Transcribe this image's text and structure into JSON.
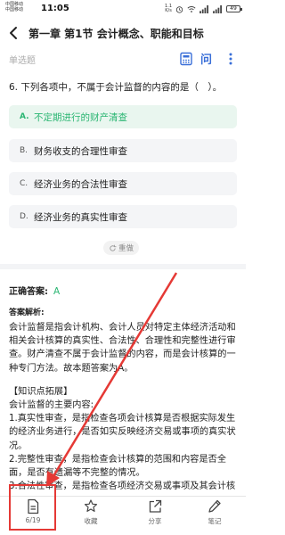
{
  "status_bar": {
    "carrier_1": "中国移动",
    "carrier_2": "中国移动",
    "time": "11:05",
    "net_speed_value": "1.1",
    "net_speed_unit": "K/s",
    "battery": "49"
  },
  "header": {
    "title": "第一章 第1节 会计概念、职能和目标"
  },
  "question": {
    "type_label": "单选题",
    "text": "6. 下列各项中，不属于会计监督的内容的是（　）。",
    "options": [
      {
        "letter": "A.",
        "text": "不定期进行的财产清查",
        "correct": true
      },
      {
        "letter": "B.",
        "text": "财务收支的合理性审查",
        "correct": false
      },
      {
        "letter": "C.",
        "text": "经济业务的合法性审查",
        "correct": false
      },
      {
        "letter": "D.",
        "text": "经济业务的真实性审查",
        "correct": false
      }
    ],
    "redo_label": "重做"
  },
  "answer": {
    "label": "正确答案:",
    "value": "A"
  },
  "analysis": {
    "label": "答案解析:",
    "paragraph_1": "会计监督是指会计机构、会计人员对特定主体经济活动和相关会计核算的真实性、合法性、合理性和完整性进行审查。财产清查不属于会计监督的内容，而是会计核算的一种专门方法。故本题答案为A。",
    "knowledge_title": "【知识点拓展】",
    "knowledge_intro": "会计监督的主要内容:",
    "point_1": "1.真实性审查，是指检查各项会计核算是否根据实际发生的经济业务进行，是否如实反映经济交易或事项的真实状况。",
    "point_2": "2.完整性审查，是指检查会计核算的范围和内容是否全面，是否有遗漏等不完整的情况。",
    "point_3": "3.合法性审查，是指检查各项经济交易或事项及其会计核"
  },
  "bottom_bar": {
    "progress": "6/19",
    "favorite": "收藏",
    "share": "分享",
    "notes": "笔记"
  },
  "colors": {
    "accent_green": "#2bb673",
    "accent_blue": "#3a6fd8",
    "annotation_red": "#e53935"
  },
  "icons": [
    "back-arrow-icon",
    "calculator-icon",
    "question-icon",
    "more-icon",
    "redo-icon",
    "answer-sheet-icon",
    "star-icon",
    "share-icon",
    "pen-icon"
  ]
}
